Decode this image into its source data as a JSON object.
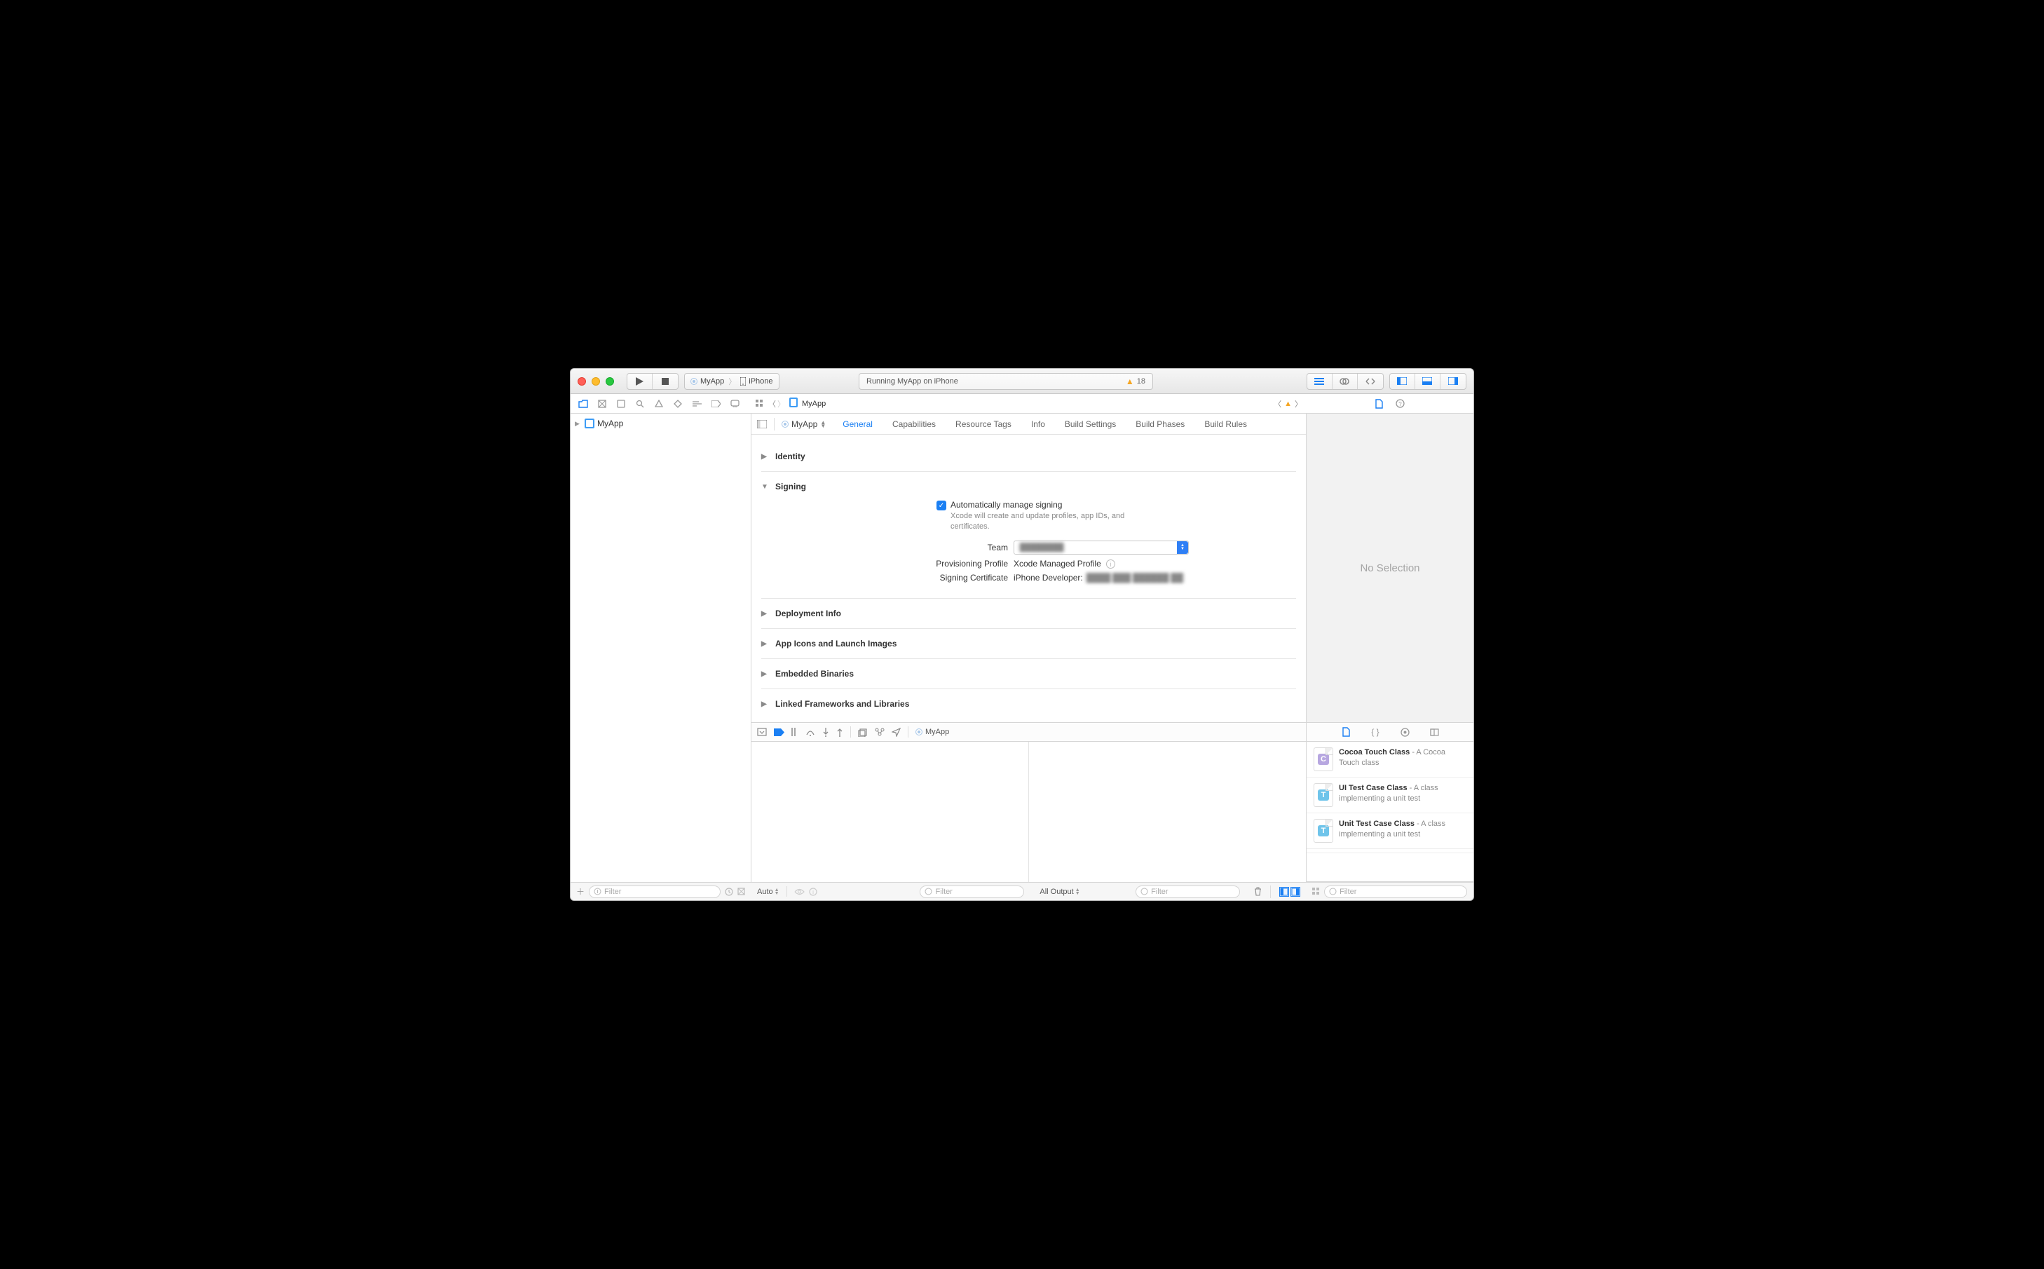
{
  "scheme": {
    "target": "MyApp",
    "device": "iPhone"
  },
  "status": {
    "text": "Running MyApp on iPhone",
    "warn_count": "18"
  },
  "nav": {
    "project_name": "MyApp"
  },
  "jumpbar": {
    "crumb": "MyApp"
  },
  "target": {
    "name": "MyApp",
    "tabs": [
      "General",
      "Capabilities",
      "Resource Tags",
      "Info",
      "Build Settings",
      "Build Phases",
      "Build Rules"
    ],
    "active_tab": "General"
  },
  "sections": {
    "identity": "Identity",
    "signing": "Signing",
    "deployment": "Deployment Info",
    "appicons": "App Icons and Launch Images",
    "embedded": "Embedded Binaries",
    "linked": "Linked Frameworks and Libraries"
  },
  "signing": {
    "checkbox_label": "Automatically manage signing",
    "checkbox_desc": "Xcode will create and update profiles, app IDs, and certificates.",
    "labels": {
      "team": "Team",
      "profile": "Provisioning Profile",
      "cert": "Signing Certificate"
    },
    "team_value": "████████",
    "profile_value": "Xcode Managed Profile",
    "cert_prefix": "iPhone Developer:",
    "cert_value": "████ ███ ██████ ██"
  },
  "debug": {
    "process": "MyApp"
  },
  "inspector": {
    "empty": "No Selection"
  },
  "library": {
    "items": [
      {
        "glyph": "C",
        "glyph_class": "c",
        "title": "Cocoa Touch Class",
        "desc": " - A Cocoa Touch class"
      },
      {
        "glyph": "T",
        "glyph_class": "t",
        "title": "UI Test Case Class",
        "desc": " - A class implementing a unit test"
      },
      {
        "glyph": "T",
        "glyph_class": "t",
        "title": "Unit Test Case Class",
        "desc": " - A class implementing a unit test"
      }
    ]
  },
  "footer": {
    "filter_placeholder": "Filter",
    "auto_label": "Auto",
    "output_label": "All Output"
  }
}
